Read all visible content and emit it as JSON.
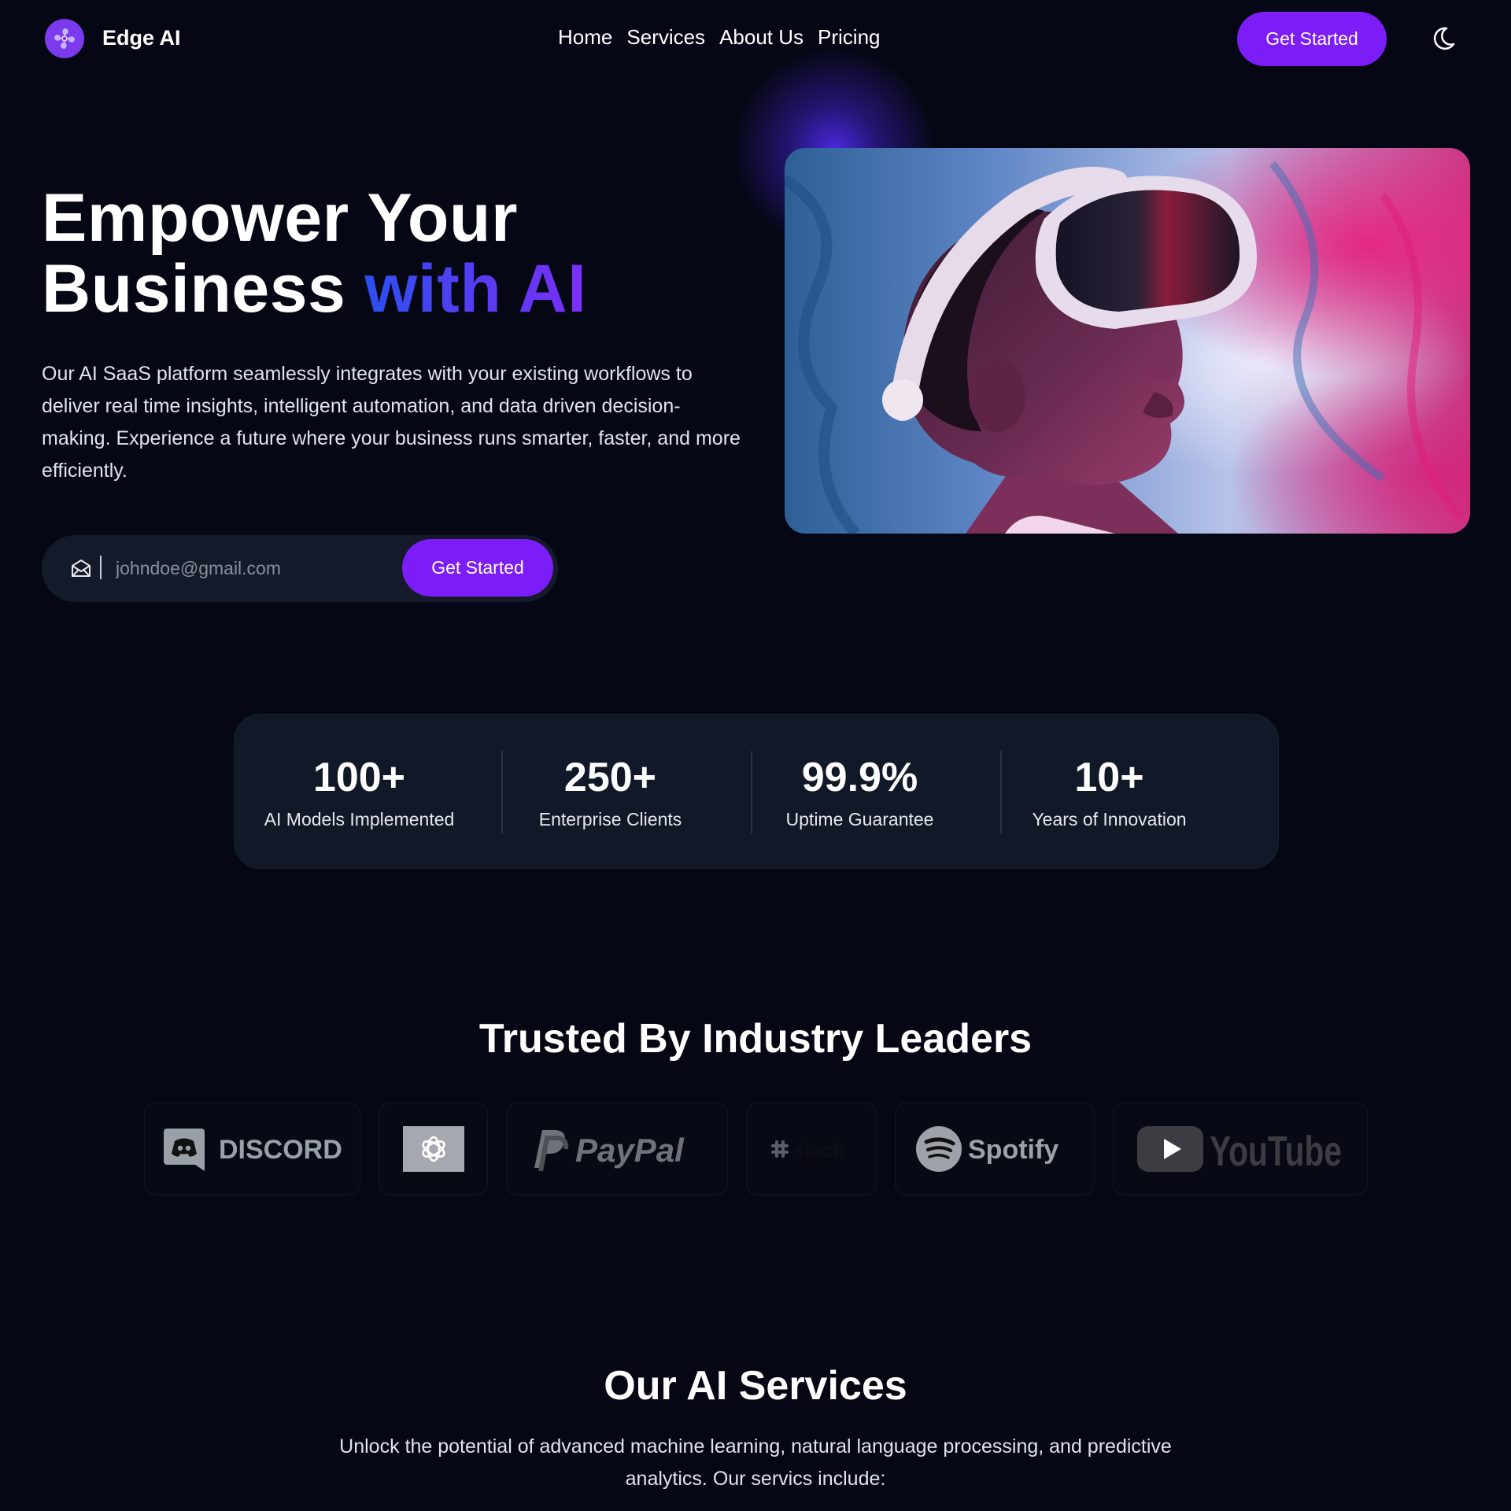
{
  "nav": {
    "brand": "Edge AI",
    "links": [
      "Home",
      "Services",
      "About Us",
      "Pricing"
    ],
    "cta_label": "Get Started"
  },
  "hero": {
    "title_line1": "Empower Your",
    "title_line2": "Business",
    "title_accent": "with AI",
    "description": "Our AI SaaS platform seamlessly integrates with your existing workflows to deliver real time insights, intelligent automation, and data driven decision-making. Experience a future where your business runs smarter, faster, and more efficiently.",
    "email_placeholder": "johndoe@gmail.com",
    "email_cta": "Get Started"
  },
  "stats": [
    {
      "value": "100+",
      "label": "AI Models Implemented"
    },
    {
      "value": "250+",
      "label": "Enterprise Clients"
    },
    {
      "value": "99.9%",
      "label": "Uptime Guarantee"
    },
    {
      "value": "10+",
      "label": "Years of Innovation"
    }
  ],
  "trusted": {
    "title": "Trusted By Industry Leaders",
    "logos": [
      "DISCORD",
      "OpenAI",
      "PayPal",
      "slack",
      "Spotify",
      "YouTube"
    ]
  },
  "services": {
    "title": "Our AI Services",
    "description": "Unlock the potential of advanced machine learning, natural language processing, and predictive analytics. Our servics include:"
  },
  "colors": {
    "background": "#050814",
    "accent": "#7c1cf6",
    "card": "#111827"
  }
}
